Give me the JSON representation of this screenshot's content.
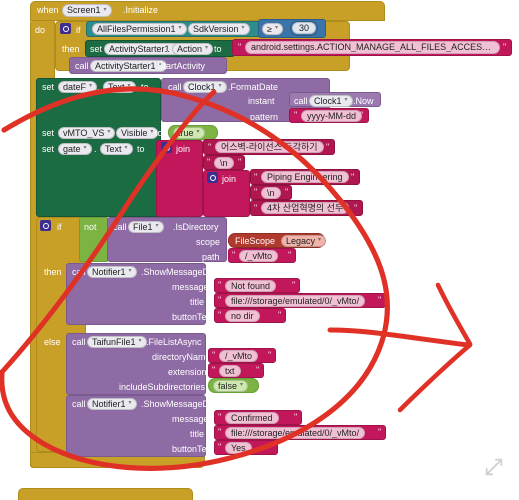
{
  "app": {
    "editor": "MIT App Inventor Blocks Editor",
    "resize_icon": "expand-diagonal-icon"
  },
  "colors": {
    "event_gold": "#c8a028",
    "setter_green": "#1b6b43",
    "procedure_purple": "#8f6ba5",
    "component_teal": "#2e8c8c",
    "math_blue": "#3a74a8",
    "text_magenta": "#c2185b",
    "logic_green": "#7cb342",
    "filescope_brick": "#b03a2e",
    "annotation_red": "#e03127"
  },
  "event_block": {
    "when": "when",
    "component": "Screen1",
    "event": ".Initialize",
    "do": "do"
  },
  "if_outer": {
    "if": "if",
    "then": "then",
    "condition": {
      "component": "AllFilesPermission1",
      "property": "SdkVersion",
      "operator": "≥",
      "value": "30"
    },
    "statements": [
      {
        "kind": "setter",
        "set": "set",
        "component": "ActivityStarter1",
        "property": "Action",
        "to": "to",
        "value": "android.settings.ACTION_MANAGE_ALL_FILES_ACCESS_..."
      },
      {
        "kind": "call",
        "call": "call",
        "component": "ActivityStarter1",
        "method": ".StartActivity"
      }
    ]
  },
  "set_datef": {
    "set": "set",
    "component": "dateF",
    "property": "Text",
    "to": "to",
    "call": "call",
    "clock": "Clock1",
    "method": ".FormatDate",
    "args": [
      {
        "name": "instant",
        "call": "call",
        "component": "Clock1",
        "method": ".Now"
      },
      {
        "name": "pattern",
        "text": "yyyy-MM-dd"
      }
    ]
  },
  "set_visible": {
    "set": "set",
    "component": "vMTO_VS",
    "property": "Visible",
    "to": "to",
    "value": "true"
  },
  "set_gate": {
    "set": "set",
    "component": "gate",
    "property": "Text",
    "to": "to",
    "join_label": "join",
    "items": [
      "어스벽-라이선스 두각하기",
      "\\n"
    ],
    "inner_join_label": "join",
    "inner_items": [
      "Piping Engineering",
      "\\n",
      "4차 산업혁명의 선두"
    ]
  },
  "if_inner": {
    "if": "if",
    "then": "then",
    "else": "else",
    "not": "not",
    "call": "call",
    "component": "File1",
    "method": ".IsDirectory",
    "args": [
      {
        "name": "scope",
        "type": "filescope",
        "label": "FileScope",
        "value": "Legacy"
      },
      {
        "name": "path",
        "type": "text",
        "value": "/_vMto"
      }
    ]
  },
  "then_branch": {
    "call": "call",
    "component": "Notifier1",
    "method": ".ShowMessageDialog",
    "args": [
      {
        "name": "message",
        "value": "Not found"
      },
      {
        "name": "title",
        "value": "file:///storage/emulated/0/_vMto/"
      },
      {
        "name": "buttonText",
        "value": "no dir"
      }
    ]
  },
  "else_branch": {
    "file_call": {
      "call": "call",
      "component": "TaifunFile1",
      "method": ".FileListAsync",
      "args": [
        {
          "name": "directoryName",
          "type": "text",
          "value": "/_vMto"
        },
        {
          "name": "extension",
          "type": "text",
          "value": "txt"
        },
        {
          "name": "includeSubdirectories",
          "type": "logic",
          "value": "false"
        }
      ]
    },
    "notifier_call": {
      "call": "call",
      "component": "Notifier1",
      "method": ".ShowMessageDialog",
      "args": [
        {
          "name": "message",
          "value": "Confirmed"
        },
        {
          "name": "title",
          "value": "file:///storage/emulated/0/_vMto/"
        },
        {
          "name": "buttonText",
          "value": "Yes"
        }
      ]
    }
  },
  "annotation": {
    "type": "hand-drawn-red-circle-with-arrow",
    "color": "#e03127"
  }
}
